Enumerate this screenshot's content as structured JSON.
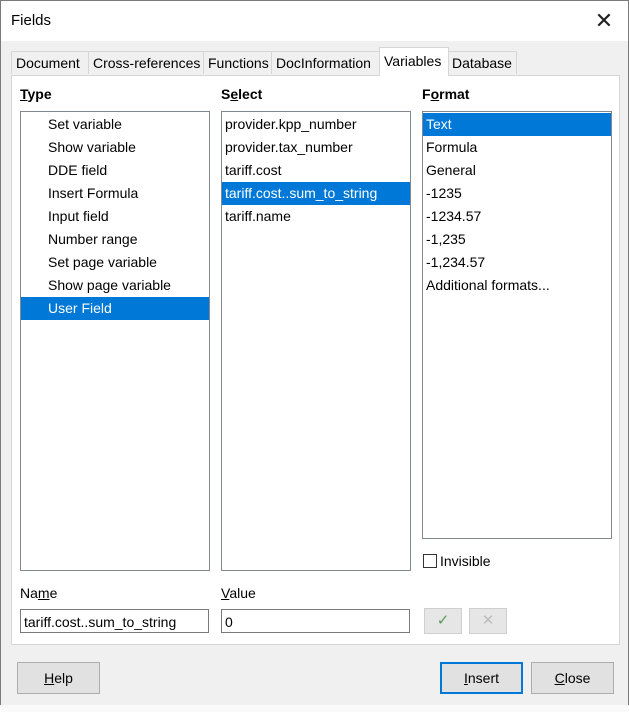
{
  "window": {
    "title": "Fields"
  },
  "tabs": [
    {
      "label": "Document"
    },
    {
      "label": "Cross-references"
    },
    {
      "label": "Functions"
    },
    {
      "label": "DocInformation"
    },
    {
      "label": "Variables",
      "active": true
    },
    {
      "label": "Database"
    }
  ],
  "type": {
    "heading": "Type",
    "items": [
      "Set variable",
      "Show variable",
      "DDE field",
      "Insert Formula",
      "Input field",
      "Number range",
      "Set page variable",
      "Show page variable",
      "User Field"
    ],
    "selected": "User Field"
  },
  "select": {
    "heading": "Select",
    "items": [
      "provider.kpp_number",
      "provider.tax_number",
      "tariff.cost",
      "tariff.cost..sum_to_string",
      "tariff.name"
    ],
    "selected": "tariff.cost..sum_to_string"
  },
  "format": {
    "heading": "Format",
    "items": [
      "Text",
      "Formula",
      "General",
      "-1235",
      "-1234.57",
      "-1,235",
      "-1,234.57",
      "Additional formats..."
    ],
    "selected": "Text"
  },
  "invisible": {
    "label": "Invisible",
    "checked": false
  },
  "name_field": {
    "label": "Name",
    "value": "tariff.cost..sum_to_string"
  },
  "value_field": {
    "label": "Value",
    "value": "0"
  },
  "buttons": {
    "apply_icon": "✓",
    "delete_icon": "✕",
    "help": "Help",
    "insert": "Insert",
    "close": "Close"
  },
  "colors": {
    "selection": "#0078d7",
    "default_button_border": "#0078d7"
  }
}
